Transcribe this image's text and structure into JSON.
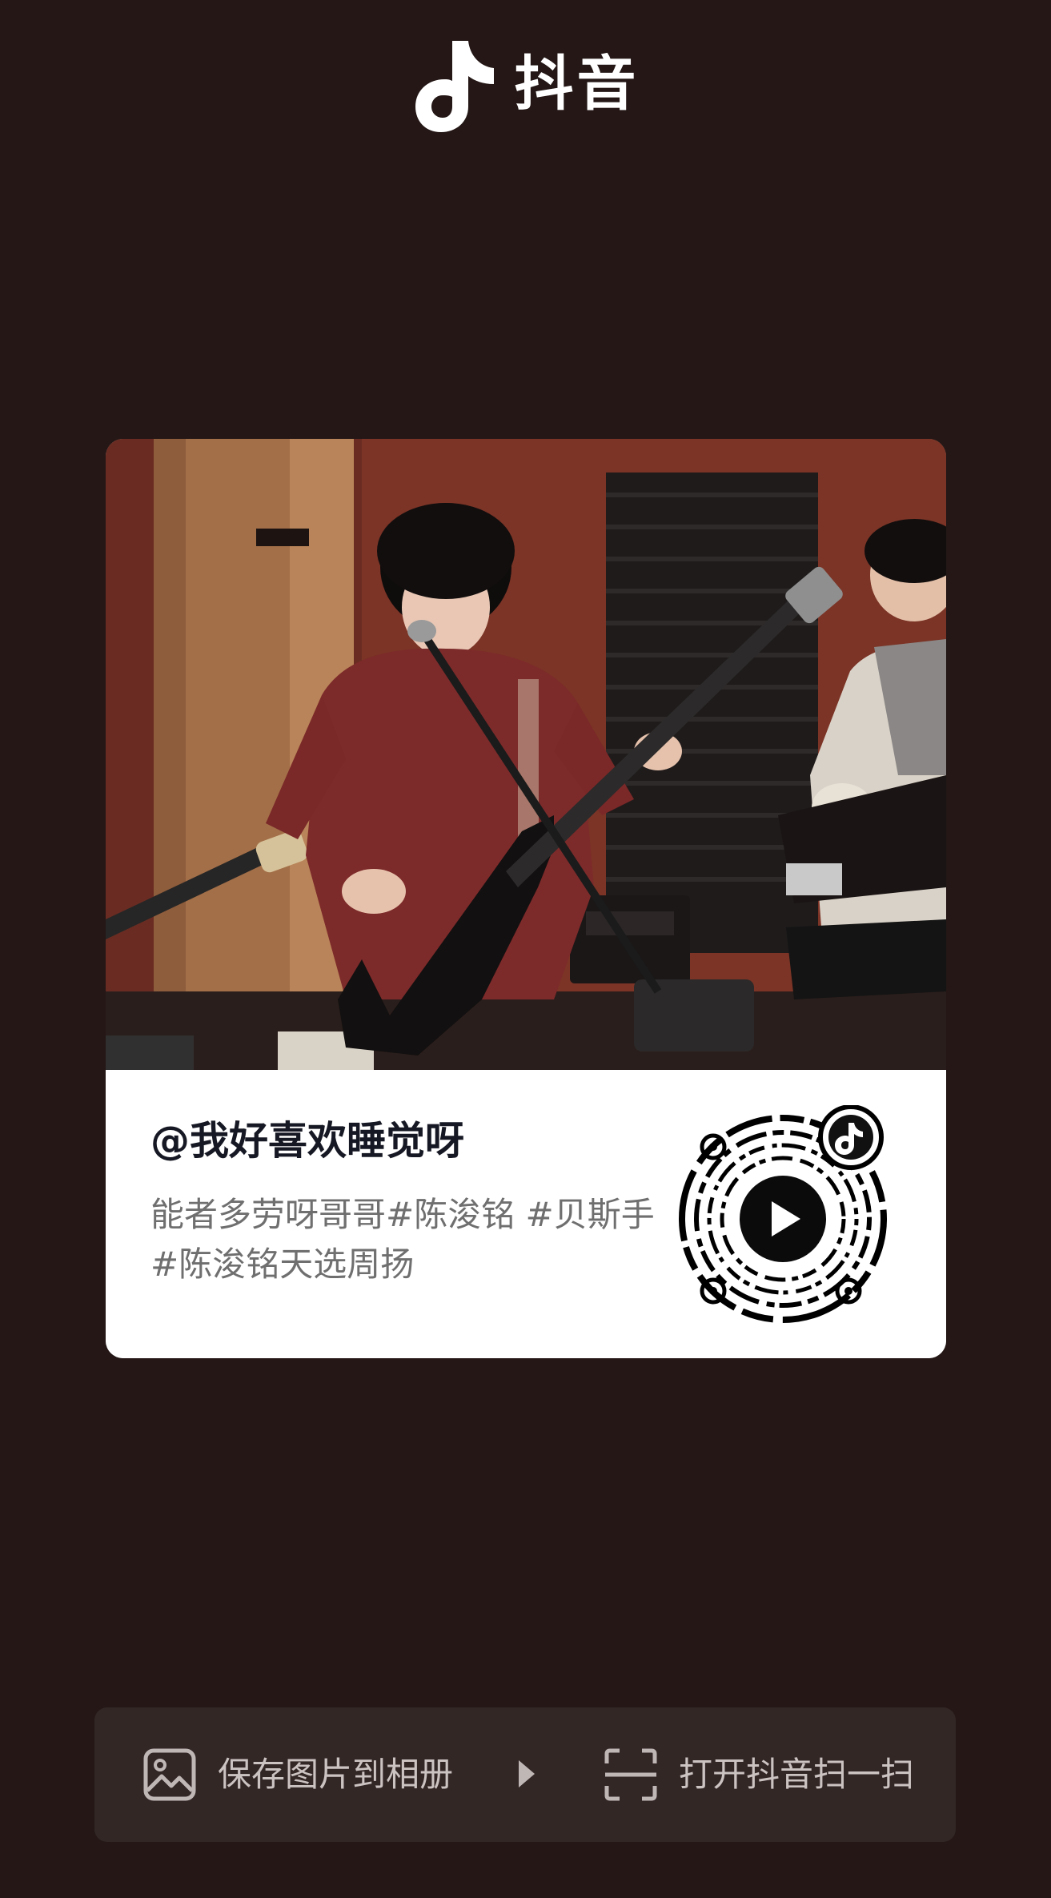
{
  "app": {
    "name": "抖音",
    "logo_icon": "douyin-note-icon"
  },
  "card": {
    "cover_image": "video-cover-band-rehearsal",
    "author": "@我好喜欢睡觉呀",
    "caption": "能者多劳呀哥哥#陈浚铭 #贝斯手#陈浚铭天选周扬",
    "qr_icon": "douyin-qr-code",
    "qr_center_icon": "play-icon",
    "qr_badge_icon": "douyin-note-icon"
  },
  "actions": {
    "save_label": "保存图片到相册",
    "save_icon": "image-icon",
    "divider_icon": "triangle-right-icon",
    "scan_label": "打开抖音扫一扫",
    "scan_icon": "scan-icon"
  },
  "colors": {
    "background": "#241716",
    "bar": "#332726",
    "card": "#ffffff",
    "text_primary": "#161823",
    "text_secondary": "#6f6f6f",
    "bar_text": "#cbc3c2"
  }
}
